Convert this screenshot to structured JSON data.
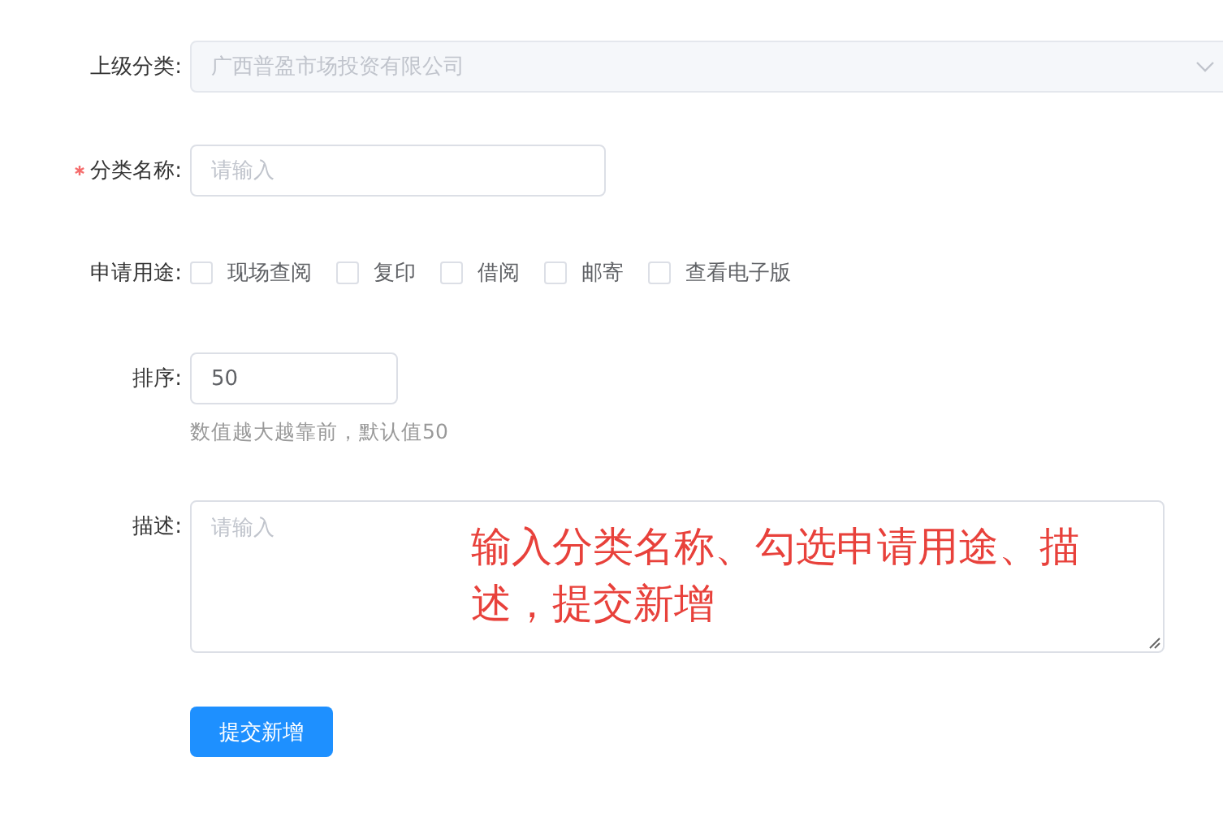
{
  "form": {
    "fields": [
      {
        "kind": "select",
        "label": "上级分类:",
        "value": "广西普盈市场投资有限公司",
        "disabled": true,
        "required": false
      },
      {
        "kind": "input",
        "label": "分类名称:",
        "placeholder": "请输入",
        "required": true
      },
      {
        "kind": "checkboxes",
        "label": "申请用途:",
        "required": false,
        "options": [
          {
            "label": "现场查阅",
            "checked": false
          },
          {
            "label": "复印",
            "checked": false
          },
          {
            "label": "借阅",
            "checked": false
          },
          {
            "label": "邮寄",
            "checked": false
          },
          {
            "label": "查看电子版",
            "checked": false
          }
        ]
      },
      {
        "kind": "number",
        "label": "排序:",
        "value": "50",
        "hint": "数值越大越靠前，默认值50",
        "required": false
      },
      {
        "kind": "textarea",
        "label": "描述:",
        "placeholder": "请输入",
        "required": false
      }
    ],
    "submit_button": "提交新增"
  },
  "annotation": "输入分类名称、勾选申请用途、描述，提交新增"
}
